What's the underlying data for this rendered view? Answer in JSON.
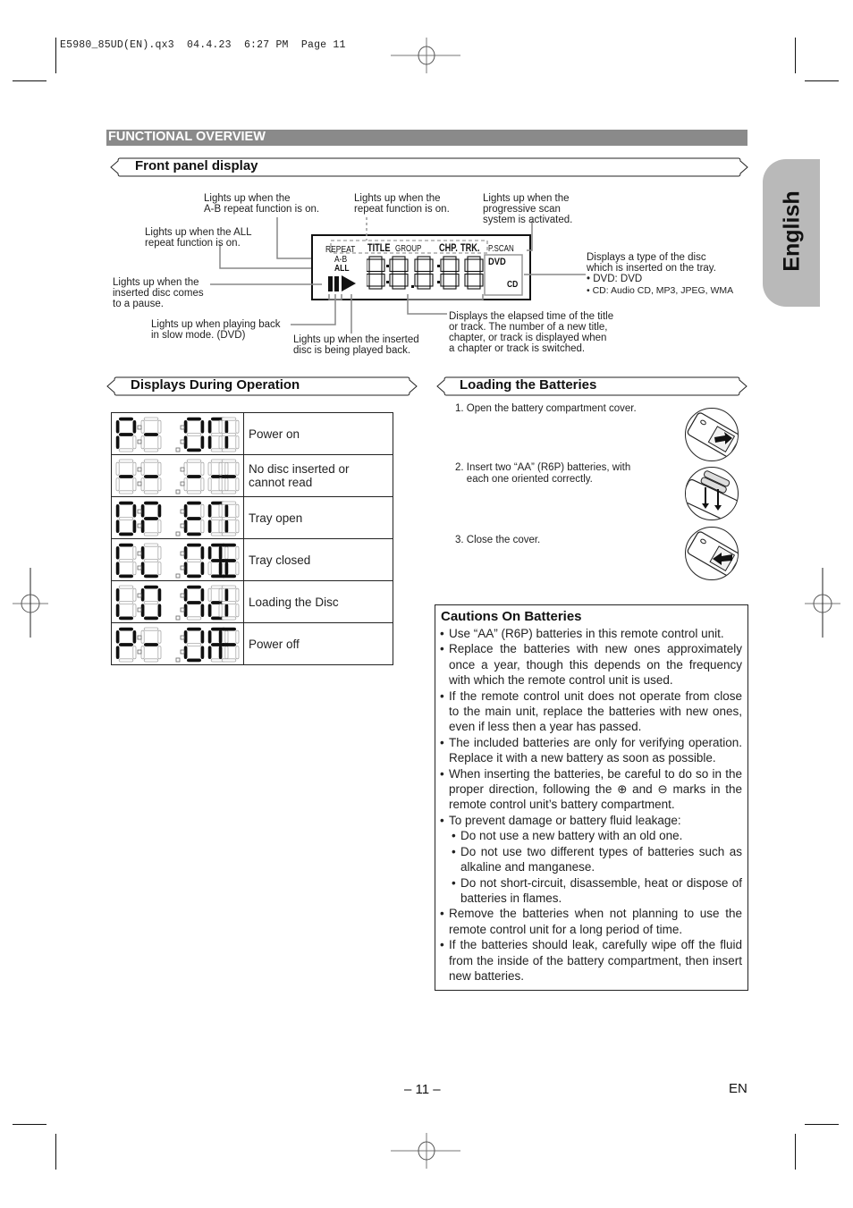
{
  "print_header": {
    "file": "E5980_85UD(EN).qx3",
    "date": "04.4.23",
    "time": "6:27 PM",
    "page_label": "Page 11"
  },
  "section_title": "FUNCTIONAL OVERVIEW",
  "language_tab": "English",
  "front_panel": {
    "heading": "Front panel display",
    "lcd": {
      "labels": {
        "repeat": "REPEAT",
        "title": "TITLE",
        "group": "GROUP",
        "chp": "CHP.",
        "trk": "TRK.",
        "pscan": "P.SCAN",
        "ab": "A-B",
        "all": "ALL",
        "dvd": "DVD",
        "cd": "CD"
      },
      "digits_top": "8·8 8·8 8",
      "digits_bottom": "8·8.8·8 8"
    },
    "callouts": {
      "ab_repeat": "Lights up when the\nA-B repeat function is on.",
      "repeat": "Lights up when the\nrepeat function is on.",
      "pscan": "Lights up when the\nprogressive scan\nsystem is activated.",
      "all_repeat": "Lights up when the ALL\nrepeat function is on.",
      "pause": "Lights up when the\ninserted disc comes\nto a pause.",
      "slow": "Lights up when playing back\nin slow mode. (DVD)",
      "play": "Lights up when the inserted\ndisc is being played back.",
      "elapsed": "Displays the elapsed time of the title\nor track. The number of a new title,\nchapter, or track is displayed when\na chapter or track is switched.",
      "disc_type": "Displays a type of the disc\nwhich is inserted on the tray.",
      "disc_type_dvd": "• DVD: DVD",
      "disc_type_cd": "• CD: Audio CD, MP3, JPEG, WMA"
    }
  },
  "displays_during_operation": {
    "heading": "Displays During Operation",
    "rows": [
      {
        "display": "P-ON",
        "label": "Power on"
      },
      {
        "display": "-----",
        "label": "No disc inserted or\ncannot read"
      },
      {
        "display": "OPEN",
        "label": "Tray open"
      },
      {
        "display": "CLOSE",
        "label": "Tray closed"
      },
      {
        "display": "LOAD",
        "label": "Loading the Disc"
      },
      {
        "display": "P-OFF",
        "label": "Power off"
      }
    ]
  },
  "loading_batteries": {
    "heading": "Loading the Batteries",
    "steps": [
      {
        "num": "1.",
        "text": "Open the battery compartment cover.",
        "icon": "remote-open-cover-icon"
      },
      {
        "num": "2.",
        "text": "Insert two “AA” (R6P) batteries, with\neach one oriented correctly.",
        "icon": "insert-batteries-icon"
      },
      {
        "num": "3.",
        "text": "Close the cover.",
        "icon": "remote-close-cover-icon"
      }
    ]
  },
  "cautions": {
    "heading": "Cautions On Batteries",
    "items": [
      {
        "level": 1,
        "text": "Use “AA” (R6P) batteries in this remote control unit."
      },
      {
        "level": 1,
        "text": "Replace the batteries with new ones approximately once a year, though this depends on the frequency with which the remote control unit is used."
      },
      {
        "level": 1,
        "text": "If the remote control unit does not operate from close to the main unit, replace the batteries with new ones, even if less then a year has passed."
      },
      {
        "level": 1,
        "text": "The included batteries are only for verifying operation. Replace it with a new battery as soon as possible."
      },
      {
        "level": 1,
        "text": "When inserting the batteries, be careful to do so in the proper direction, following the ⊕ and ⊖ marks in the remote control unit’s battery compartment."
      },
      {
        "level": 1,
        "text": "To prevent damage or battery fluid leakage:"
      },
      {
        "level": 2,
        "text": "Do not use a new battery with an old one."
      },
      {
        "level": 2,
        "text": "Do not use two different types of batteries such as alkaline and manganese."
      },
      {
        "level": 2,
        "text": "Do not short-circuit, disassemble, heat or dispose of batteries in flames."
      },
      {
        "level": 1,
        "text": "Remove the batteries when not planning to use the remote control unit for a long period of time."
      },
      {
        "level": 1,
        "text": "If the batteries should leak, carefully wipe off the fluid from the inside of the battery compartment, then insert new batteries."
      }
    ]
  },
  "footer": {
    "page_number": "– 11 –",
    "language_code": "EN"
  }
}
